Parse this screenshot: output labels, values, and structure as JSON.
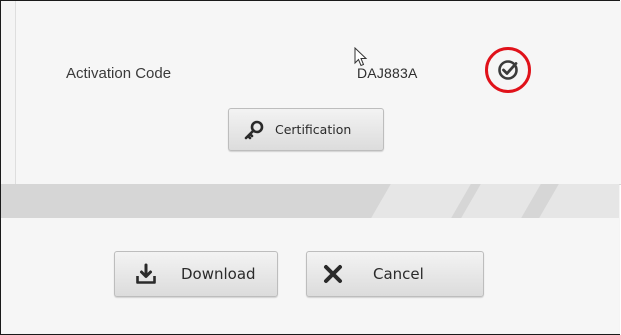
{
  "activation": {
    "label": "Activation Code",
    "code": "DAJ883A"
  },
  "icons": {
    "verified": "check-circle-icon",
    "certification": "key-icon",
    "download": "download-icon",
    "cancel": "close-icon",
    "cursor": "mouse-cursor-icon"
  },
  "buttons": {
    "certification": "Certification",
    "download": "Download",
    "cancel": "Cancel"
  },
  "colors": {
    "highlight_ring": "#e0121a"
  }
}
